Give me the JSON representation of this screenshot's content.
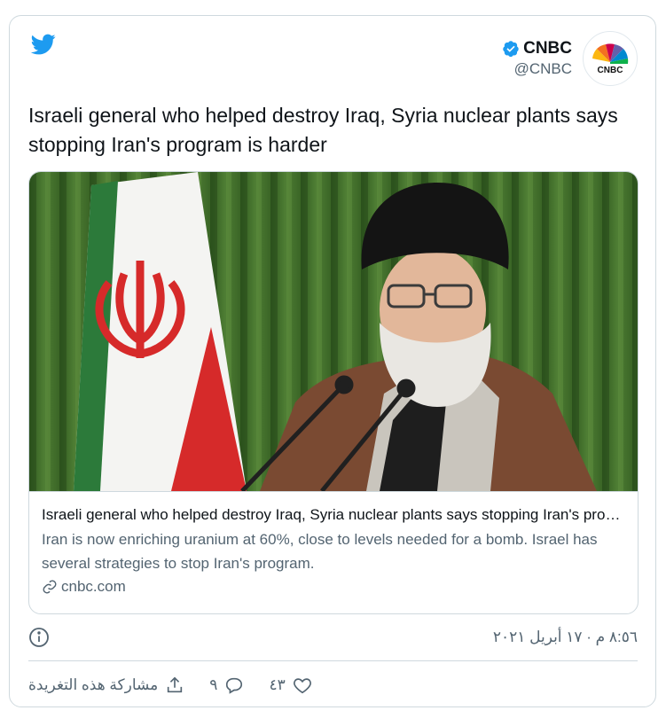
{
  "brand": {
    "accent": "#1d9bf0",
    "icon": "twitter-bird-icon"
  },
  "author": {
    "name": "CNBC",
    "handle": "@CNBC",
    "avatar_text": "CNBC",
    "verified_icon": "verified-badge-icon"
  },
  "tweet": {
    "text": "Israeli general who helped destroy Iraq, Syria nuclear plants says stopping Iran's program is harder"
  },
  "card": {
    "image_icon": "photo-iran-leader-icon",
    "title": "Israeli general who helped destroy Iraq, Syria nuclear plants says stopping Iran's program is harder",
    "description": "Iran is now enriching uranium at 60%, close to levels needed for a bomb. Israel has several strategies to stop Iran's program.",
    "domain": "cnbc.com",
    "link_icon": "link-icon"
  },
  "meta": {
    "timestamp": "٨:٥٦ م · ١٧ أبريل ٢٠٢١",
    "info_icon": "info-icon"
  },
  "actions": {
    "likes": "٤٣",
    "replies": "٩",
    "share_label": "مشاركة هذه التغريدة"
  }
}
